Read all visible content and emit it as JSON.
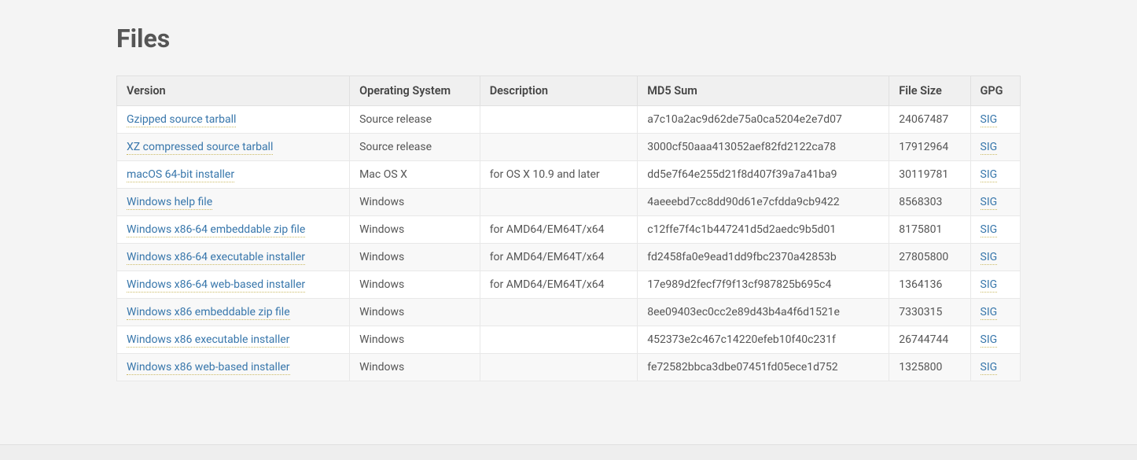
{
  "title": "Files",
  "columns": {
    "version": "Version",
    "os": "Operating System",
    "description": "Description",
    "md5": "MD5 Sum",
    "size": "File Size",
    "gpg": "GPG"
  },
  "sig_label": "SIG",
  "files": [
    {
      "version": "Gzipped source tarball",
      "os": "Source release",
      "description": "",
      "md5": "a7c10a2ac9d62de75a0ca5204e2e7d07",
      "size": "24067487"
    },
    {
      "version": "XZ compressed source tarball",
      "os": "Source release",
      "description": "",
      "md5": "3000cf50aaa413052aef82fd2122ca78",
      "size": "17912964"
    },
    {
      "version": "macOS 64-bit installer",
      "os": "Mac OS X",
      "description": "for OS X 10.9 and later",
      "md5": "dd5e7f64e255d21f8d407f39a7a41ba9",
      "size": "30119781"
    },
    {
      "version": "Windows help file",
      "os": "Windows",
      "description": "",
      "md5": "4aeeebd7cc8dd90d61e7cfdda9cb9422",
      "size": "8568303"
    },
    {
      "version": "Windows x86-64 embeddable zip file",
      "os": "Windows",
      "description": "for AMD64/EM64T/x64",
      "md5": "c12ffe7f4c1b447241d5d2aedc9b5d01",
      "size": "8175801"
    },
    {
      "version": "Windows x86-64 executable installer",
      "os": "Windows",
      "description": "for AMD64/EM64T/x64",
      "md5": "fd2458fa0e9ead1dd9fbc2370a42853b",
      "size": "27805800"
    },
    {
      "version": "Windows x86-64 web-based installer",
      "os": "Windows",
      "description": "for AMD64/EM64T/x64",
      "md5": "17e989d2fecf7f9f13cf987825b695c4",
      "size": "1364136"
    },
    {
      "version": "Windows x86 embeddable zip file",
      "os": "Windows",
      "description": "",
      "md5": "8ee09403ec0cc2e89d43b4a4f6d1521e",
      "size": "7330315"
    },
    {
      "version": "Windows x86 executable installer",
      "os": "Windows",
      "description": "",
      "md5": "452373e2c467c14220efeb10f40c231f",
      "size": "26744744"
    },
    {
      "version": "Windows x86 web-based installer",
      "os": "Windows",
      "description": "",
      "md5": "fe72582bbca3dbe07451fd05ece1d752",
      "size": "1325800"
    }
  ]
}
